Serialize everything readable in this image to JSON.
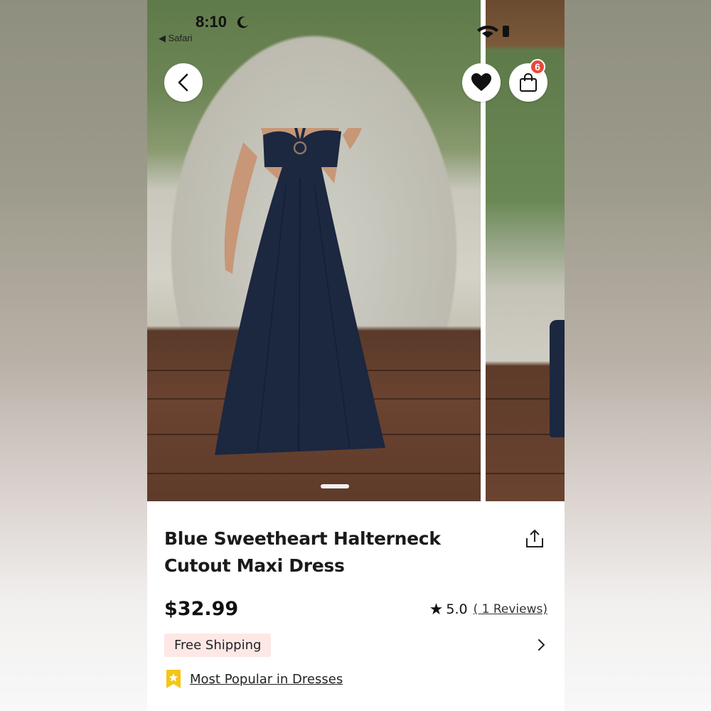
{
  "status_bar": {
    "time": "8:10",
    "back_app": "◀ Safari"
  },
  "gallery": {
    "active_index": 0,
    "icons": {
      "back": "back-arrow-icon",
      "favorite": "heart-icon",
      "cart": "shopping-bag-icon"
    },
    "cart_count": "6"
  },
  "product": {
    "title": "Blue Sweetheart Halterneck Cutout Maxi Dress",
    "price": "$32.99",
    "rating_star": "★",
    "rating": "5.0",
    "reviews": "( 1 Reviews)",
    "free_shipping": "Free Shipping",
    "popular": "Most Popular in Dresses"
  },
  "colors": {
    "accent_badge": "#e8493a",
    "shipping_bg": "#fde8e6",
    "popular_icon": "#f5c518",
    "dress": "#1c2740"
  }
}
